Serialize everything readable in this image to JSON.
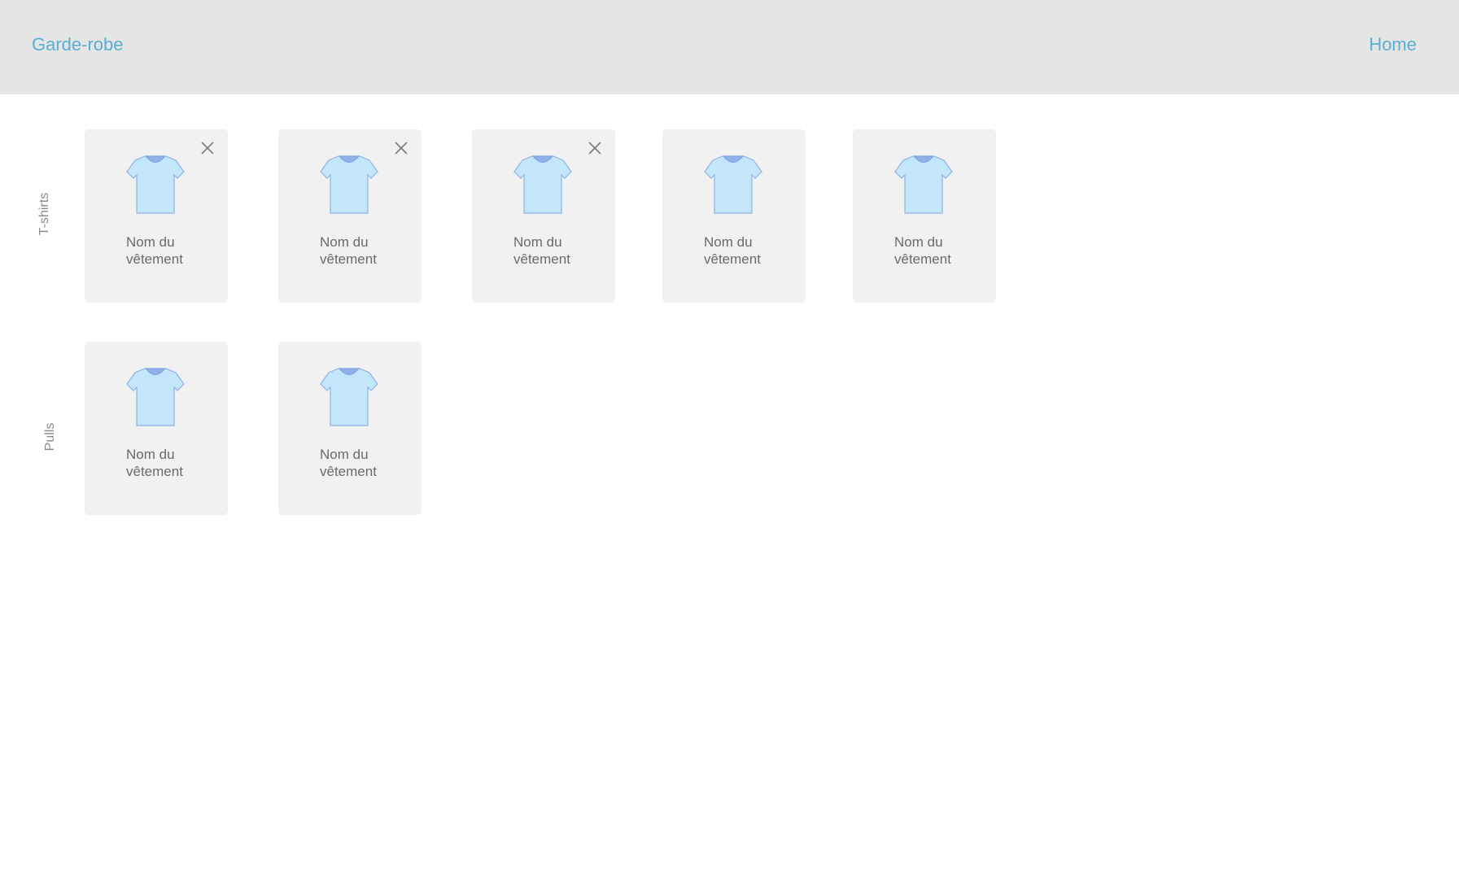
{
  "header": {
    "brand": "Garde-robe",
    "home_link": "Home"
  },
  "rows": [
    {
      "label": "T-shirts",
      "items": [
        {
          "name": "Nom du vêtement",
          "removable": true,
          "icon": "tshirt-icon"
        },
        {
          "name": "Nom du vêtement",
          "removable": true,
          "icon": "tshirt-icon"
        },
        {
          "name": "Nom du vêtement",
          "removable": true,
          "icon": "tshirt-icon"
        },
        {
          "name": "Nom du vêtement",
          "removable": false,
          "icon": "tshirt-icon"
        },
        {
          "name": "Nom du vêtement",
          "removable": false,
          "icon": "tshirt-icon"
        }
      ]
    },
    {
      "label": "Pulls",
      "items": [
        {
          "name": "Nom du vêtement",
          "removable": false,
          "icon": "tshirt-icon"
        },
        {
          "name": "Nom du vêtement",
          "removable": false,
          "icon": "tshirt-icon"
        }
      ]
    }
  ],
  "colors": {
    "accent": "#5aaed3",
    "header_bg": "#e5e5e5",
    "card_bg": "#f1f1f1",
    "shirt_fill": "#c4e6fb",
    "shirt_stroke": "#8db3e6",
    "collar": "#8fb0e8"
  }
}
